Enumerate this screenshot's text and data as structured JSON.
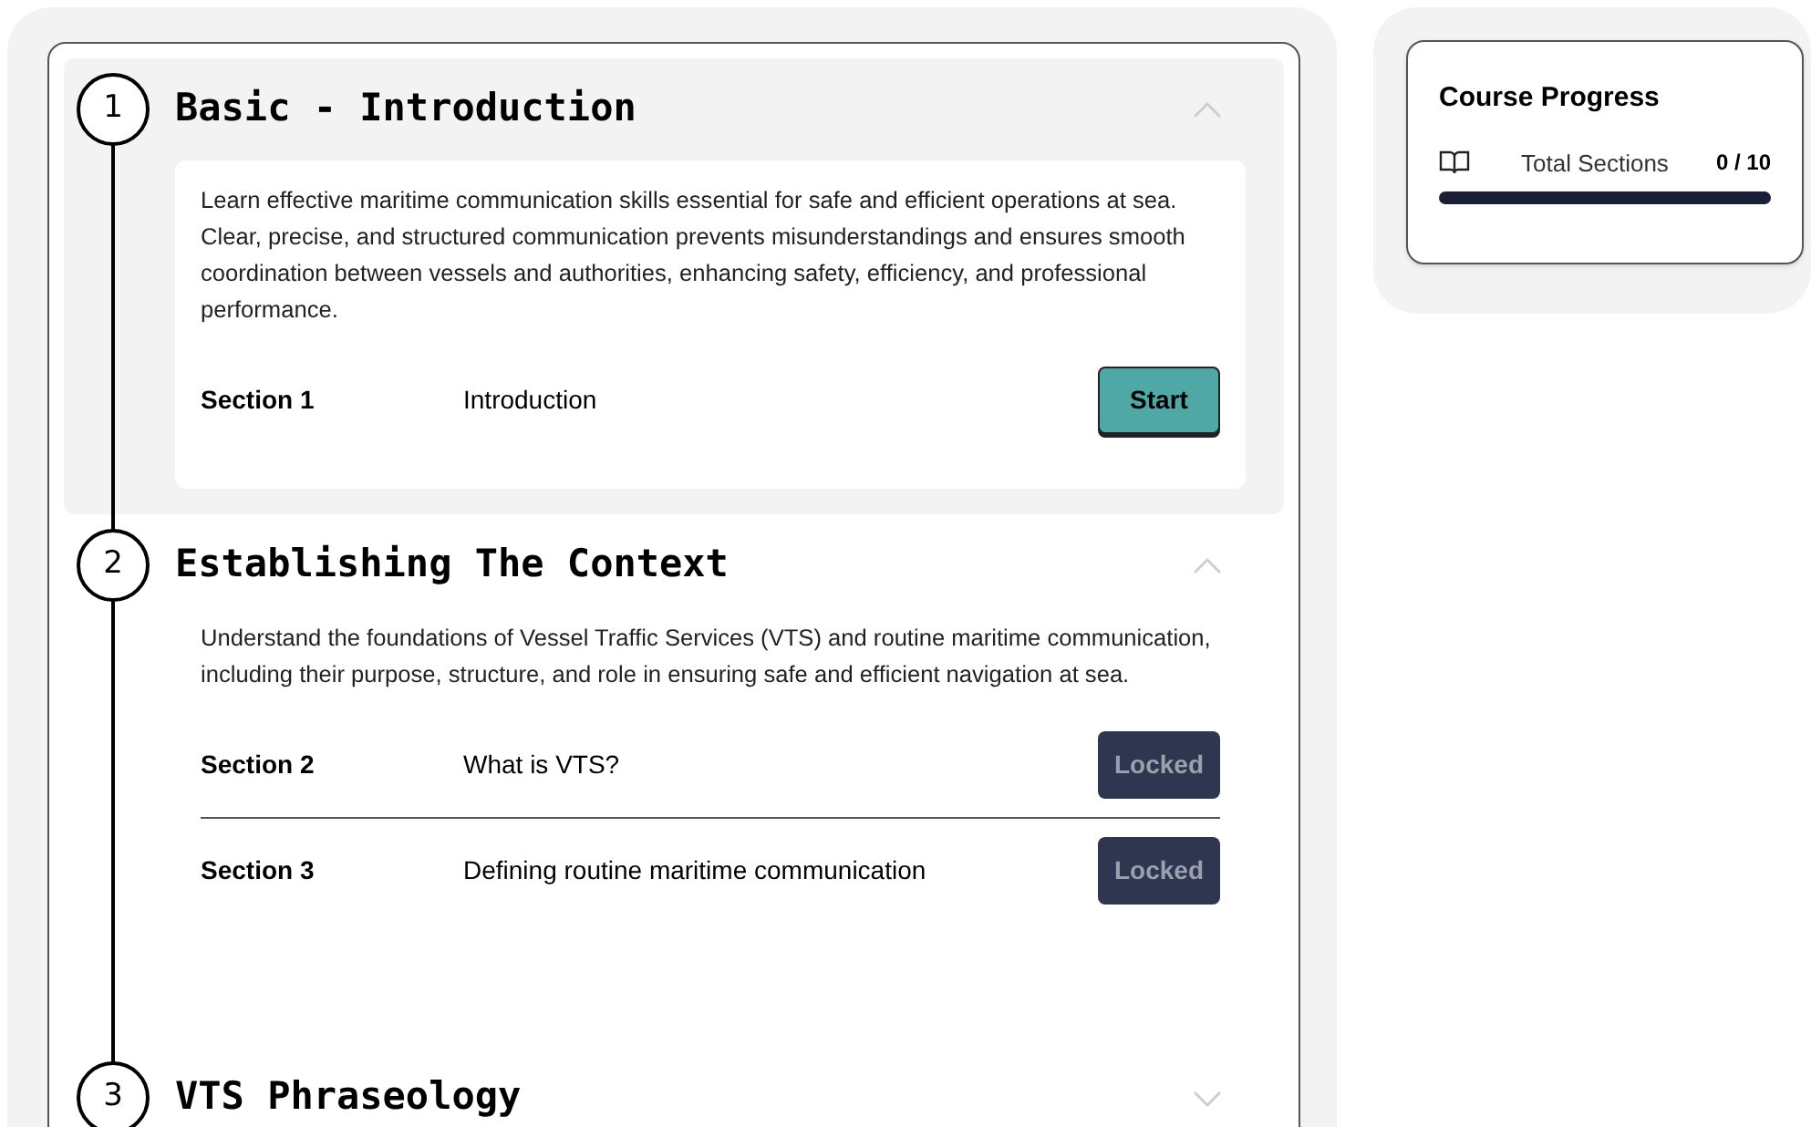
{
  "modules": [
    {
      "number": "1",
      "title": "Basic - Introduction",
      "expanded": true,
      "selected": true,
      "description": "Learn effective maritime communication skills essential for safe and efficient operations at sea. Clear, precise, and structured communication prevents misunderstandings and ensures smooth coordination between vessels and authorities, enhancing safety, efficiency, and professional performance.",
      "sections": [
        {
          "label": "Section 1",
          "name": "Introduction",
          "kind": "start",
          "button": "Start"
        }
      ]
    },
    {
      "number": "2",
      "title": "Establishing The Context",
      "expanded": true,
      "selected": false,
      "description": "Understand the foundations of Vessel Traffic Services (VTS) and routine maritime communication, including their purpose, structure, and role in ensuring safe and efficient navigation at sea.",
      "sections": [
        {
          "label": "Section 2",
          "name": "What is VTS?",
          "kind": "locked",
          "button": "Locked"
        },
        {
          "label": "Section 3",
          "name": "Defining routine maritime communication",
          "kind": "locked",
          "button": "Locked"
        }
      ]
    },
    {
      "number": "3",
      "title": "VTS Phraseology",
      "expanded": false,
      "selected": false
    }
  ],
  "progress": {
    "title": "Course Progress",
    "label": "Total Sections",
    "count": "0 / 10",
    "level": 0
  }
}
